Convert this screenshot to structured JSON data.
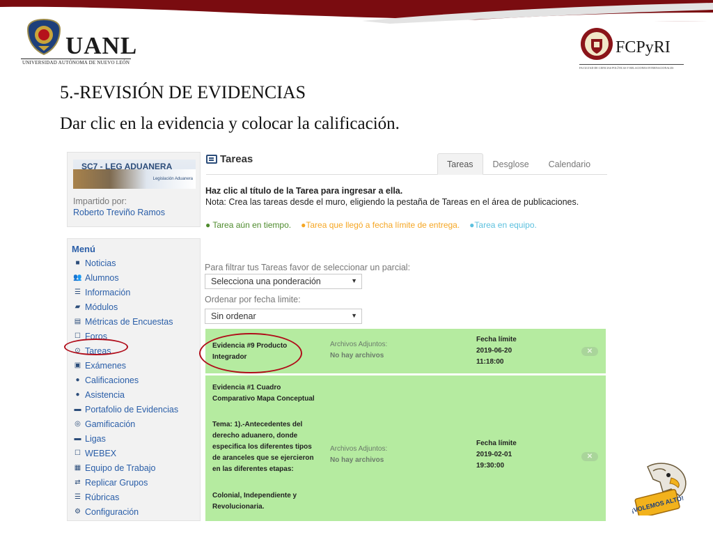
{
  "colors": {
    "top_band_dark": "#7a0c10",
    "top_band_gray": "#e3e3e3",
    "link_blue": "#2a5ea8",
    "task_green": "#b5eba0",
    "highlight_red": "#b00d1a",
    "legend_green": "#4e8b2d",
    "legend_orange": "#f5a623",
    "legend_cyan": "#5bc0de"
  },
  "slide": {
    "uanl_name": "UANL",
    "uanl_subtitle": "UNIVERSIDAD AUTÓNOMA DE NUEVO LEÓN",
    "fcpyri_name": "FCPyRI",
    "fcpyri_subtitle": "FACULTAD DE CIENCIAS POLÍTICAS Y RELACIONES INTERNACIONALES",
    "heading": "5.-REVISIÓN DE EVIDENCIAS",
    "subheading": "Dar clic en la evidencia y colocar la calificación.",
    "mascot_text": "¡VOLEMOS ALTO!"
  },
  "lms": {
    "course": {
      "code": "SC7 - LEG ADUANERA",
      "banner_caption": "Legislación Aduanera",
      "taught_by_label": "Impartido por:",
      "teacher": "Roberto Treviño Ramos"
    },
    "menu": {
      "title": "Menú",
      "items": [
        {
          "label": "Noticias",
          "icon": "news-icon",
          "glyph": "■"
        },
        {
          "label": "Alumnos",
          "icon": "users-icon",
          "glyph": "👥"
        },
        {
          "label": "Información",
          "icon": "list-icon",
          "glyph": "☰"
        },
        {
          "label": "Módulos",
          "icon": "modules-icon",
          "glyph": "▰"
        },
        {
          "label": "Métricas de Encuestas",
          "icon": "metrics-icon",
          "glyph": "▤"
        },
        {
          "label": "Foros",
          "icon": "forum-icon",
          "glyph": "☐"
        },
        {
          "label": "Tareas",
          "icon": "clock-icon",
          "glyph": "⊙"
        },
        {
          "label": "Exámenes",
          "icon": "exam-icon",
          "glyph": "▣"
        },
        {
          "label": "Calificaciones",
          "icon": "check-circle-icon",
          "glyph": "●"
        },
        {
          "label": "Asistencia",
          "icon": "pin-icon",
          "glyph": "●"
        },
        {
          "label": "Portafolio de Evidencias",
          "icon": "briefcase-icon",
          "glyph": "▬"
        },
        {
          "label": "Gamificación",
          "icon": "gamepad-icon",
          "glyph": "◎"
        },
        {
          "label": "Ligas",
          "icon": "link-icon",
          "glyph": "▬"
        },
        {
          "label": "WEBEX",
          "icon": "webex-icon",
          "glyph": "☐"
        },
        {
          "label": "Equipo de Trabajo",
          "icon": "team-icon",
          "glyph": "▦"
        },
        {
          "label": "Replicar Grupos",
          "icon": "replicate-icon",
          "glyph": "⇄"
        },
        {
          "label": "Rúbricas",
          "icon": "rubric-icon",
          "glyph": "☰"
        },
        {
          "label": "Configuración",
          "icon": "gear-icon",
          "glyph": "⚙"
        }
      ]
    },
    "main": {
      "title": "Tareas",
      "tabs": [
        {
          "label": "Tareas",
          "active": true
        },
        {
          "label": "Desglose",
          "active": false
        },
        {
          "label": "Calendario",
          "active": false
        }
      ],
      "instruction": "Haz clic al título de la Tarea para ingresar a ella.",
      "note": "Nota: Crea las tareas desde el muro, eligiendo la pestaña de Tareas en el área de publicaciones.",
      "legend": [
        {
          "label": "● Tarea aún en tiempo.",
          "color": "#4e8b2d"
        },
        {
          "label": "●Tarea que llegó a fecha límite de entrega.",
          "color": "#f5a623"
        },
        {
          "label": "●Tarea en equipo.",
          "color": "#5bc0de"
        }
      ],
      "filter_label": "Para filtrar tus Tareas favor de seleccionar un parcial:",
      "filter_select": "Selecciona una ponderación",
      "order_label": "Ordenar por fecha limite:",
      "order_select": "Sin ordenar",
      "tasks": [
        {
          "title": "Evidencia #9 Producto Integrador",
          "attach_label": "Archivos Adjuntos:",
          "attach_value": "No hay archivos",
          "due_label": "Fecha límite",
          "due_date": "2019-06-20",
          "due_time": "11:18:00",
          "close": "✕"
        },
        {
          "title": "Evidencia #1 Cuadro Comparativo Mapa Conceptual",
          "tema": "Tema: 1).-Antecedentes del derecho aduanero, donde especifica los diferentes tipos de aranceles que se ejercieron en las diferentes etapas:",
          "extra": "Colonial, Independiente y Revolucionaria.",
          "attach_label": "Archivos Adjuntos:",
          "attach_value": "No hay archivos",
          "due_label": "Fecha límite",
          "due_date": "2019-02-01",
          "due_time": "19:30:00",
          "close": "✕"
        }
      ]
    }
  }
}
